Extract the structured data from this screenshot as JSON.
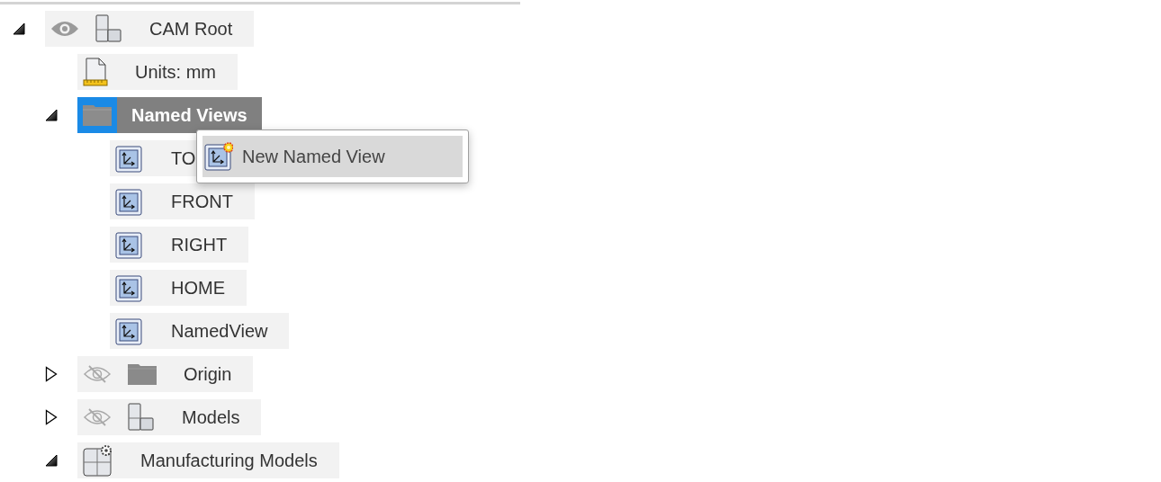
{
  "tree": [
    {
      "label": "CAM Root",
      "kind": "component",
      "visible": true,
      "expanded": true,
      "selected": false,
      "children": [
        {
          "label": "Units: mm",
          "kind": "units",
          "selected": false
        },
        {
          "label": "Named Views",
          "kind": "folder",
          "expanded": true,
          "selected": true,
          "children": [
            {
              "label": "TO",
              "kind": "view",
              "selected": false
            },
            {
              "label": "FRONT",
              "kind": "view",
              "selected": false
            },
            {
              "label": "RIGHT",
              "kind": "view",
              "selected": false
            },
            {
              "label": "HOME",
              "kind": "view",
              "selected": false
            },
            {
              "label": "NamedView",
              "kind": "view",
              "selected": false
            }
          ]
        },
        {
          "label": "Origin",
          "kind": "folder",
          "visible": false,
          "expanded": false,
          "selected": false
        },
        {
          "label": "Models",
          "kind": "component",
          "visible": false,
          "expanded": false,
          "selected": false
        },
        {
          "label": "Manufacturing Models",
          "kind": "manufacturing",
          "expanded": true,
          "selected": false
        }
      ]
    }
  ],
  "context_menu": {
    "items": [
      {
        "label": "New Named View",
        "kind": "new-view",
        "selected": true
      }
    ]
  }
}
